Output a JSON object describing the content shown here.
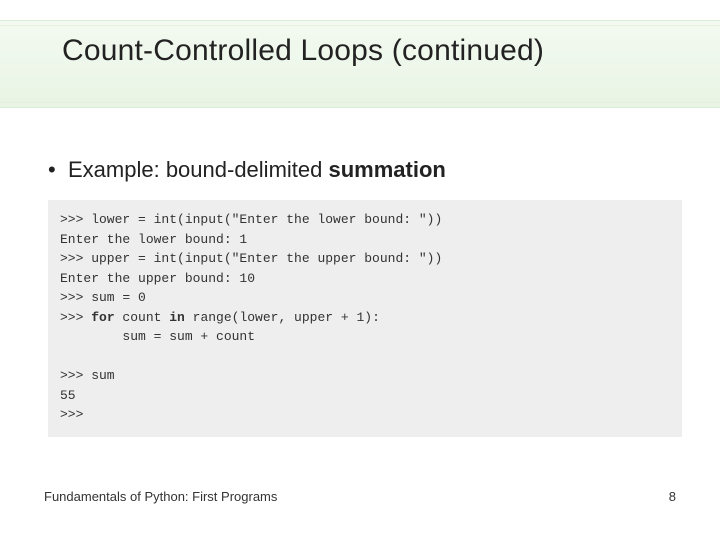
{
  "title": "Count-Controlled Loops (continued)",
  "bullet": {
    "marker": "•",
    "text_prefix": "Example: bound-delimited ",
    "text_bold": "summation"
  },
  "code": {
    "l1_a": ">>> lower = int(input(\"Enter the lower bound: \"))",
    "l2": "Enter the lower bound: 1",
    "l3_a": ">>> upper = int(input(\"Enter the upper bound: \"))",
    "l4": "Enter the upper bound: 10",
    "l5": ">>> sum = 0",
    "l6_a": ">>> ",
    "l6_kw1": "for",
    "l6_b": " count ",
    "l6_kw2": "in",
    "l6_c": " range(lower, upper + 1):",
    "l7": "        sum = sum + count",
    "l8": "",
    "l9": ">>> sum",
    "l10": "55",
    "l11": ">>>"
  },
  "footer": {
    "left": "Fundamentals of Python: First Programs",
    "right": "8"
  }
}
